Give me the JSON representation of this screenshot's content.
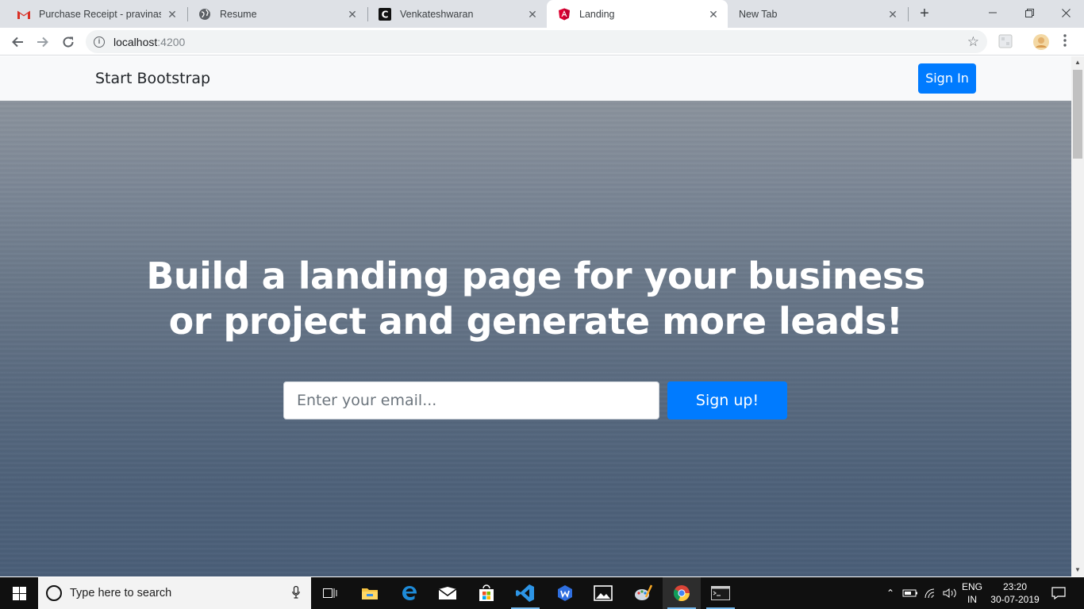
{
  "browser": {
    "tabs": [
      {
        "title": "Purchase Receipt - pravinaswin",
        "icon": "gmail-icon"
      },
      {
        "title": "Resume",
        "icon": "globe-icon"
      },
      {
        "title": "Venkateshwaran",
        "icon": "c-logo-icon"
      },
      {
        "title": "Landing",
        "icon": "angular-icon",
        "active": true
      },
      {
        "title": "New Tab",
        "icon": "none"
      }
    ],
    "url_host": "localhost",
    "url_port": ":4200"
  },
  "page": {
    "brand": "Start Bootstrap",
    "signin_label": "Sign In",
    "headline_line1": "Build a landing page for your business",
    "headline_line2": "or project and generate more leads!",
    "email_placeholder": "Enter your email...",
    "signup_label": "Sign up!"
  },
  "taskbar": {
    "search_placeholder": "Type here to search",
    "apps": [
      "task-view-icon",
      "file-explorer-icon",
      "edge-icon",
      "mail-icon",
      "store-icon",
      "vscode-icon",
      "wps-icon",
      "photos-icon",
      "paint-icon",
      "chrome-icon",
      "terminal-icon"
    ],
    "lang_line1": "ENG",
    "lang_line2": "IN",
    "time": "23:20",
    "date": "30-07-2019"
  },
  "colors": {
    "primary": "#007bff",
    "navbar_bg": "#f8f9fa",
    "tabstrip_bg": "#dee1e6",
    "taskbar_bg": "#101010"
  }
}
